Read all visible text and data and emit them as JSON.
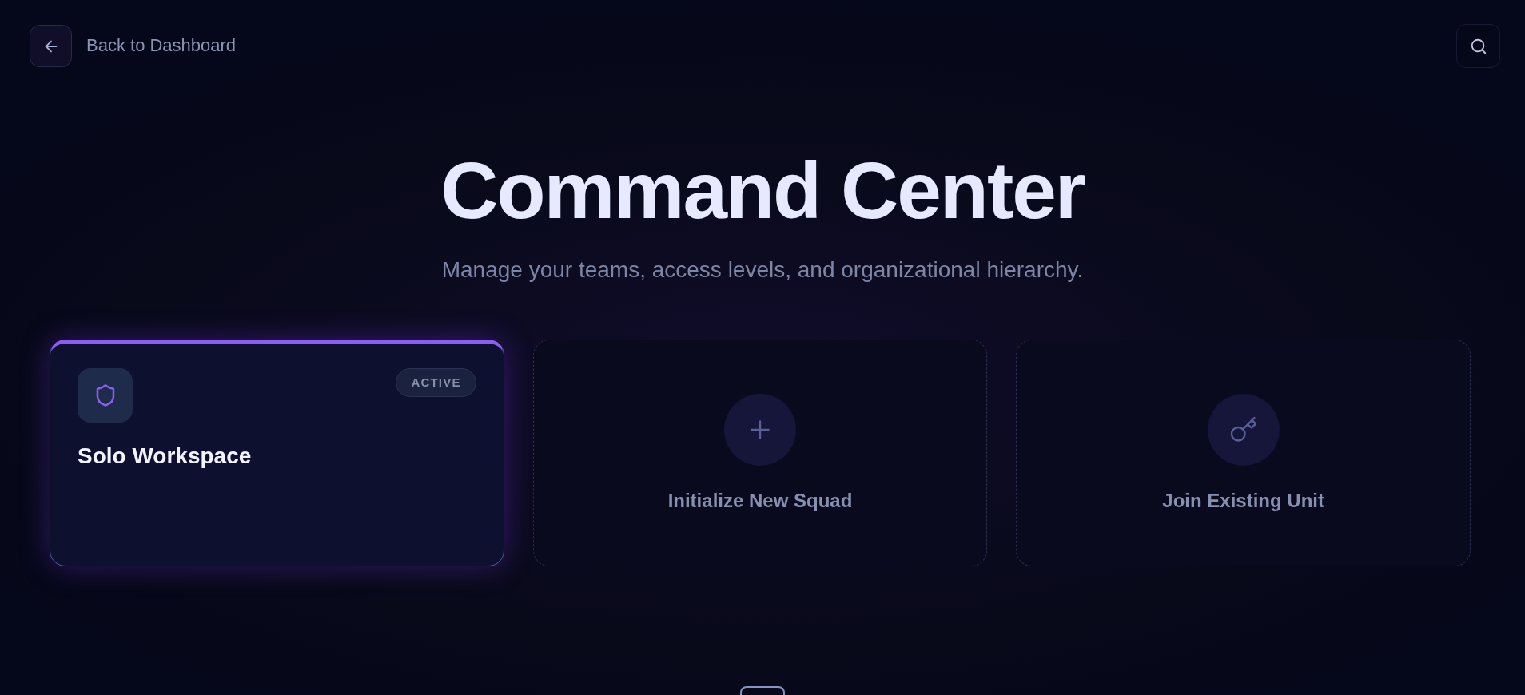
{
  "header": {
    "back_link": "Back to Dashboard"
  },
  "hero": {
    "title": "Command Center",
    "subtitle": "Manage your teams, access levels, and organizational hierarchy."
  },
  "cards": [
    {
      "kind": "workspace",
      "title": "Solo Workspace",
      "badge": "ACTIVE"
    },
    {
      "kind": "create",
      "label": "Initialize New Squad"
    },
    {
      "kind": "join",
      "label": "Join Existing Unit"
    }
  ]
}
